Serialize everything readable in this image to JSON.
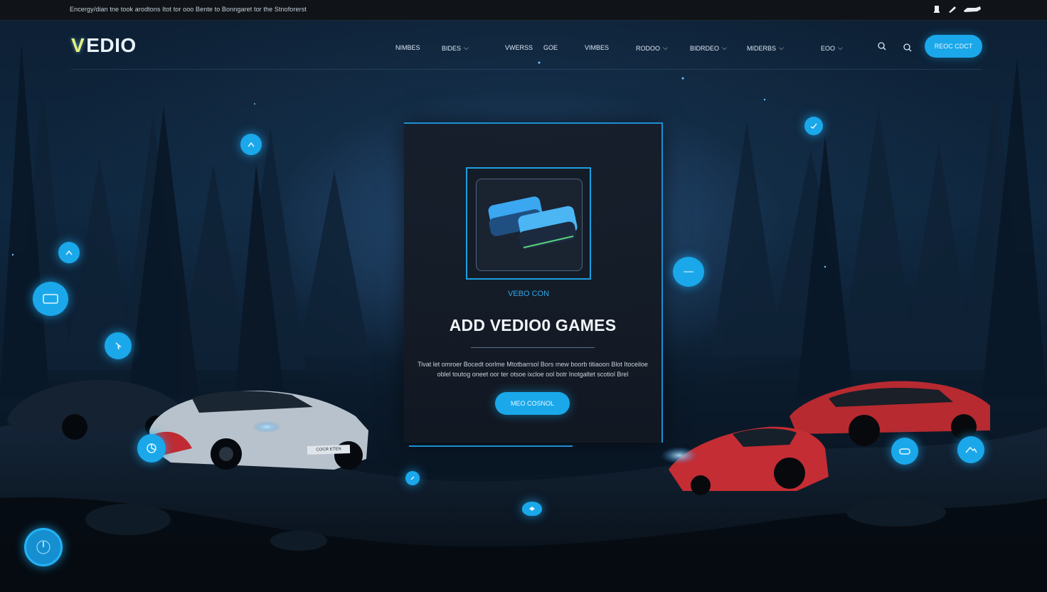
{
  "top_strip": {
    "note": "Encergy/dian tne took arodtons  Itot tor ooo  Bente to Bonngaret tor the Stnoforerst",
    "icons": [
      "user-icon",
      "tool-icon",
      "vehicle-icon"
    ]
  },
  "brand": {
    "mark": "V",
    "name": "EDIO"
  },
  "nav": {
    "items": [
      {
        "label": "NIMBES",
        "dropdown": false
      },
      {
        "label": "BIDES",
        "dropdown": true
      },
      {
        "label": "VWERSS",
        "dropdown": false
      },
      {
        "label": "GOE",
        "dropdown": false
      },
      {
        "label": "VIMBES",
        "dropdown": false
      },
      {
        "label": "RODOO",
        "dropdown": true
      },
      {
        "label": "BIDRDEO",
        "dropdown": true
      },
      {
        "label": "MIDERBS",
        "dropdown": true
      },
      {
        "label": "EOO",
        "dropdown": true
      }
    ],
    "icons": [
      "search-icon",
      "search-icon"
    ],
    "cta_label": "REOC CDCT"
  },
  "panel": {
    "icon_name": "gamepad-icon",
    "icon_caption": "VEBO CON",
    "title": "ADD VEDIO0 GAMES",
    "text": "Tivat let omroer Bocedt oorlme Mtotbarrsol Bors mew boorb titiaoon Blot  Itoceiloe oblel toutog oneet oor ter otsoe ixcloe ool botr Inotgaltet scotiol Brel",
    "button_label": "MEO COSNOL"
  },
  "scene": {
    "plate": "COCR ETEN"
  },
  "colors": {
    "accent": "#1aa8ea",
    "panel_border": "#1d8fd4",
    "logo_mark": "#e9f07a"
  }
}
